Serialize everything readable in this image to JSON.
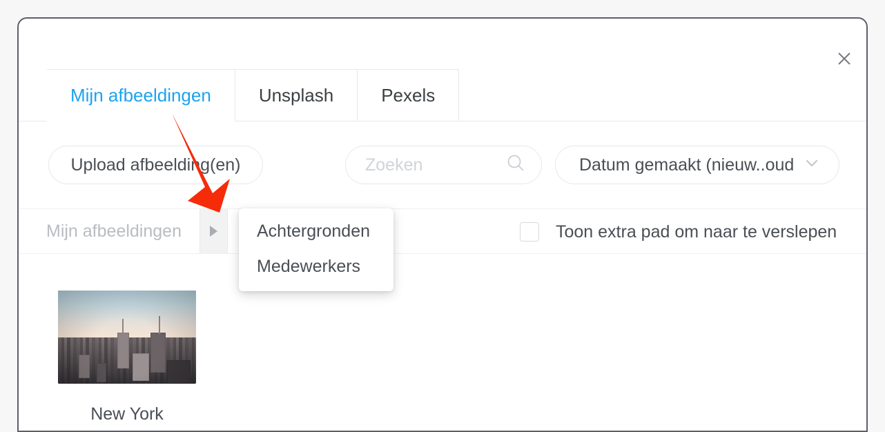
{
  "dialog": {
    "close_icon": "close-icon"
  },
  "tabs": [
    {
      "label": "Mijn afbeeldingen",
      "active": true
    },
    {
      "label": "Unsplash",
      "active": false
    },
    {
      "label": "Pexels",
      "active": false
    }
  ],
  "toolbar": {
    "upload_label": "Upload afbeelding(en)",
    "search_placeholder": "Zoeken",
    "search_value": "",
    "search_icon": "search-icon",
    "sort_value": "Datum gemaakt (nieuw..oud",
    "sort_chevron_icon": "chevron-down-icon"
  },
  "breadcrumb": {
    "root_label": "Mijn afbeeldingen",
    "expand_icon": "triangle-right-icon"
  },
  "folder_menu": {
    "items": [
      {
        "label": "Achtergronden"
      },
      {
        "label": "Medewerkers"
      }
    ]
  },
  "drag_option": {
    "label": "Toon extra pad om naar te verslepen",
    "checked": false
  },
  "images": [
    {
      "title": "New York"
    }
  ],
  "colors": {
    "accent": "#1aa3f0",
    "text": "#4a4f55",
    "muted": "#b9bcc1",
    "border": "#e4e8ee",
    "annotation_red": "#f52b0a",
    "modal_border": "#5b5f66"
  }
}
